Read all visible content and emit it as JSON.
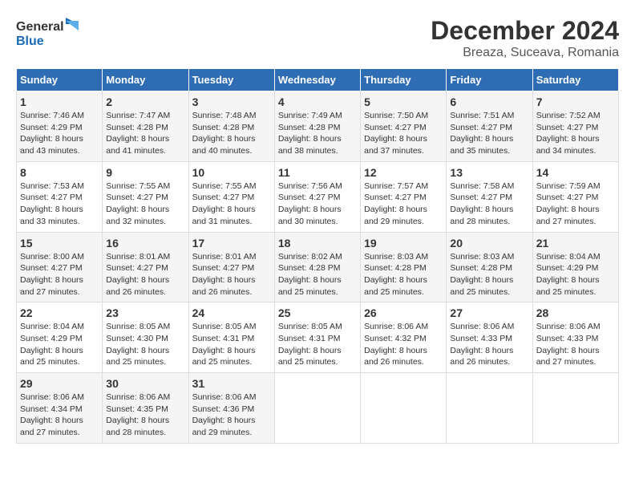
{
  "header": {
    "logo_line1": "General",
    "logo_line2": "Blue",
    "title": "December 2024",
    "subtitle": "Breaza, Suceava, Romania"
  },
  "weekdays": [
    "Sunday",
    "Monday",
    "Tuesday",
    "Wednesday",
    "Thursday",
    "Friday",
    "Saturday"
  ],
  "weeks": [
    [
      {
        "day": "1",
        "lines": [
          "Sunrise: 7:46 AM",
          "Sunset: 4:29 PM",
          "Daylight: 8 hours",
          "and 43 minutes."
        ]
      },
      {
        "day": "2",
        "lines": [
          "Sunrise: 7:47 AM",
          "Sunset: 4:28 PM",
          "Daylight: 8 hours",
          "and 41 minutes."
        ]
      },
      {
        "day": "3",
        "lines": [
          "Sunrise: 7:48 AM",
          "Sunset: 4:28 PM",
          "Daylight: 8 hours",
          "and 40 minutes."
        ]
      },
      {
        "day": "4",
        "lines": [
          "Sunrise: 7:49 AM",
          "Sunset: 4:28 PM",
          "Daylight: 8 hours",
          "and 38 minutes."
        ]
      },
      {
        "day": "5",
        "lines": [
          "Sunrise: 7:50 AM",
          "Sunset: 4:27 PM",
          "Daylight: 8 hours",
          "and 37 minutes."
        ]
      },
      {
        "day": "6",
        "lines": [
          "Sunrise: 7:51 AM",
          "Sunset: 4:27 PM",
          "Daylight: 8 hours",
          "and 35 minutes."
        ]
      },
      {
        "day": "7",
        "lines": [
          "Sunrise: 7:52 AM",
          "Sunset: 4:27 PM",
          "Daylight: 8 hours",
          "and 34 minutes."
        ]
      }
    ],
    [
      {
        "day": "8",
        "lines": [
          "Sunrise: 7:53 AM",
          "Sunset: 4:27 PM",
          "Daylight: 8 hours",
          "and 33 minutes."
        ]
      },
      {
        "day": "9",
        "lines": [
          "Sunrise: 7:55 AM",
          "Sunset: 4:27 PM",
          "Daylight: 8 hours",
          "and 32 minutes."
        ]
      },
      {
        "day": "10",
        "lines": [
          "Sunrise: 7:55 AM",
          "Sunset: 4:27 PM",
          "Daylight: 8 hours",
          "and 31 minutes."
        ]
      },
      {
        "day": "11",
        "lines": [
          "Sunrise: 7:56 AM",
          "Sunset: 4:27 PM",
          "Daylight: 8 hours",
          "and 30 minutes."
        ]
      },
      {
        "day": "12",
        "lines": [
          "Sunrise: 7:57 AM",
          "Sunset: 4:27 PM",
          "Daylight: 8 hours",
          "and 29 minutes."
        ]
      },
      {
        "day": "13",
        "lines": [
          "Sunrise: 7:58 AM",
          "Sunset: 4:27 PM",
          "Daylight: 8 hours",
          "and 28 minutes."
        ]
      },
      {
        "day": "14",
        "lines": [
          "Sunrise: 7:59 AM",
          "Sunset: 4:27 PM",
          "Daylight: 8 hours",
          "and 27 minutes."
        ]
      }
    ],
    [
      {
        "day": "15",
        "lines": [
          "Sunrise: 8:00 AM",
          "Sunset: 4:27 PM",
          "Daylight: 8 hours",
          "and 27 minutes."
        ]
      },
      {
        "day": "16",
        "lines": [
          "Sunrise: 8:01 AM",
          "Sunset: 4:27 PM",
          "Daylight: 8 hours",
          "and 26 minutes."
        ]
      },
      {
        "day": "17",
        "lines": [
          "Sunrise: 8:01 AM",
          "Sunset: 4:27 PM",
          "Daylight: 8 hours",
          "and 26 minutes."
        ]
      },
      {
        "day": "18",
        "lines": [
          "Sunrise: 8:02 AM",
          "Sunset: 4:28 PM",
          "Daylight: 8 hours",
          "and 25 minutes."
        ]
      },
      {
        "day": "19",
        "lines": [
          "Sunrise: 8:03 AM",
          "Sunset: 4:28 PM",
          "Daylight: 8 hours",
          "and 25 minutes."
        ]
      },
      {
        "day": "20",
        "lines": [
          "Sunrise: 8:03 AM",
          "Sunset: 4:28 PM",
          "Daylight: 8 hours",
          "and 25 minutes."
        ]
      },
      {
        "day": "21",
        "lines": [
          "Sunrise: 8:04 AM",
          "Sunset: 4:29 PM",
          "Daylight: 8 hours",
          "and 25 minutes."
        ]
      }
    ],
    [
      {
        "day": "22",
        "lines": [
          "Sunrise: 8:04 AM",
          "Sunset: 4:29 PM",
          "Daylight: 8 hours",
          "and 25 minutes."
        ]
      },
      {
        "day": "23",
        "lines": [
          "Sunrise: 8:05 AM",
          "Sunset: 4:30 PM",
          "Daylight: 8 hours",
          "and 25 minutes."
        ]
      },
      {
        "day": "24",
        "lines": [
          "Sunrise: 8:05 AM",
          "Sunset: 4:31 PM",
          "Daylight: 8 hours",
          "and 25 minutes."
        ]
      },
      {
        "day": "25",
        "lines": [
          "Sunrise: 8:05 AM",
          "Sunset: 4:31 PM",
          "Daylight: 8 hours",
          "and 25 minutes."
        ]
      },
      {
        "day": "26",
        "lines": [
          "Sunrise: 8:06 AM",
          "Sunset: 4:32 PM",
          "Daylight: 8 hours",
          "and 26 minutes."
        ]
      },
      {
        "day": "27",
        "lines": [
          "Sunrise: 8:06 AM",
          "Sunset: 4:33 PM",
          "Daylight: 8 hours",
          "and 26 minutes."
        ]
      },
      {
        "day": "28",
        "lines": [
          "Sunrise: 8:06 AM",
          "Sunset: 4:33 PM",
          "Daylight: 8 hours",
          "and 27 minutes."
        ]
      }
    ],
    [
      {
        "day": "29",
        "lines": [
          "Sunrise: 8:06 AM",
          "Sunset: 4:34 PM",
          "Daylight: 8 hours",
          "and 27 minutes."
        ]
      },
      {
        "day": "30",
        "lines": [
          "Sunrise: 8:06 AM",
          "Sunset: 4:35 PM",
          "Daylight: 8 hours",
          "and 28 minutes."
        ]
      },
      {
        "day": "31",
        "lines": [
          "Sunrise: 8:06 AM",
          "Sunset: 4:36 PM",
          "Daylight: 8 hours",
          "and 29 minutes."
        ]
      },
      null,
      null,
      null,
      null
    ]
  ]
}
